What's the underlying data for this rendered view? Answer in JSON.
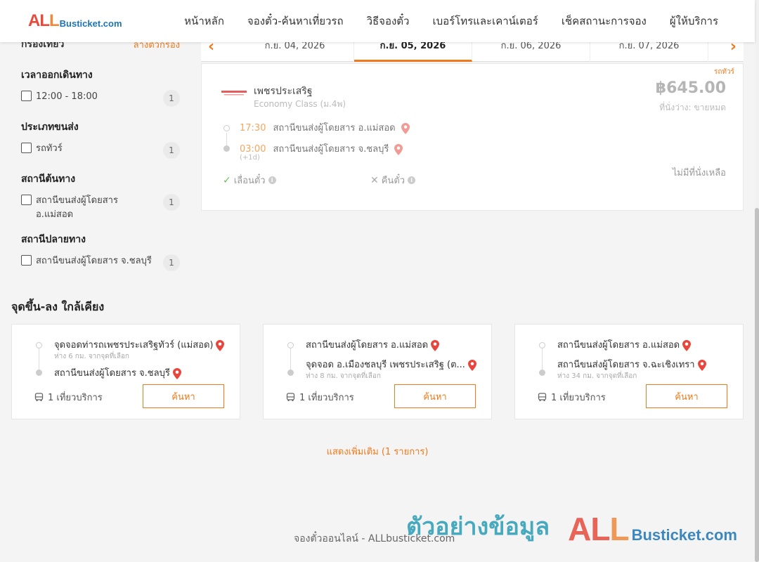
{
  "brand": {
    "logo_all": "ALL",
    "logo_rest": "Busticket.com"
  },
  "nav": [
    "หน้าหลัก",
    "จองตั๋ว-ค้นหาเที่ยวรถ",
    "วิธีจองตั๋ว",
    "เบอร์โทรและเคาน์เตอร์",
    "เช็คสถานะการจอง",
    "ผู้ให้บริการ"
  ],
  "filters": {
    "title": "กรองเที่ยว",
    "clear": "ล้างตัวกรอง",
    "groups": [
      {
        "title": "เวลาออกเดินทาง",
        "options": [
          {
            "label": "12:00 - 18:00",
            "count": "1"
          }
        ]
      },
      {
        "title": "ประเภทขนส่ง",
        "options": [
          {
            "label": "รถทัวร์",
            "count": "1"
          }
        ]
      },
      {
        "title": "สถานีต้นทาง",
        "options": [
          {
            "label": "สถานีขนส่งผู้โดยสาร อ.แม่สอด",
            "count": "1"
          }
        ]
      },
      {
        "title": "สถานีปลายทาง",
        "options": [
          {
            "label": "สถานีขนส่งผู้โดยสาร จ.ชลบุรี",
            "count": "1"
          }
        ]
      }
    ]
  },
  "dates": [
    "ก.ย. 04, 2026",
    "ก.ย. 05, 2026",
    "ก.ย. 06, 2026",
    "ก.ย. 07, 2026"
  ],
  "active_date_index": 1,
  "trip": {
    "type_tag": "รถทัวร์",
    "operator": "เพชรประเสริฐ",
    "class": "Economy Class (ม.4พ)",
    "price": "฿645.00",
    "seats": "ที่นั่งว่าง: ขายหมด",
    "depart_time": "17:30",
    "depart_station": "สถานีขนส่งผู้โดยสาร อ.แม่สอด",
    "arrive_time": "03:00",
    "arrive_station": "สถานีขนส่งผู้โดยสาร จ.ชลบุรี",
    "next_day": "(+1d)",
    "reschedule": "เลื่อนตั๋ว",
    "refund": "คืนตั๋ว",
    "no_seat": "ไม่มีที่นั่งเหลือ"
  },
  "nearby": {
    "title": "จุดขึ้น-ลง ใกล้เคียง",
    "cards": [
      {
        "from": "จุดจอดท่ารถเพชรประเสริฐทัวร์ (แม่สอด)",
        "from_dist": "ห่าง 6 กม. จากจุดที่เลือก",
        "to": "สถานีขนส่งผู้โดยสาร จ.ชลบุรี",
        "to_dist": "",
        "trips": "1 เที่ยวบริการ",
        "button": "ค้นหา"
      },
      {
        "from": "สถานีขนส่งผู้โดยสาร อ.แม่สอด",
        "from_dist": "",
        "to": "จุดจอด อ.เมืองชลบุรี เพชรประเสริฐ (ต...",
        "to_dist": "ห่าง 8 กม. จากจุดที่เลือก",
        "trips": "1 เที่ยวบริการ",
        "button": "ค้นหา"
      },
      {
        "from": "สถานีขนส่งผู้โดยสาร อ.แม่สอด",
        "from_dist": "",
        "to": "สถานีขนส่งผู้โดยสาร จ.ฉะเชิงเทรา",
        "to_dist": "ห่าง 34 กม. จากจุดที่เลือก",
        "trips": "1 เที่ยวบริการ",
        "button": "ค้นหา"
      }
    ]
  },
  "show_more": "แสดงเพิ่มเติม (1 รายการ)",
  "footer": "จองตั๋วออนไลน์ - ALLbusticket.com",
  "watermark": {
    "text": "ตัวอย่างข้อมูล",
    "logo_all": "ALL",
    "logo_rest": "Busticket.com"
  },
  "colors": {
    "accent": "#f07a1b",
    "pin": "#e8453c",
    "brand_red": "#e84a3c",
    "brand_blue": "#1d74b4",
    "watermark_teal": "#2a9db5"
  }
}
